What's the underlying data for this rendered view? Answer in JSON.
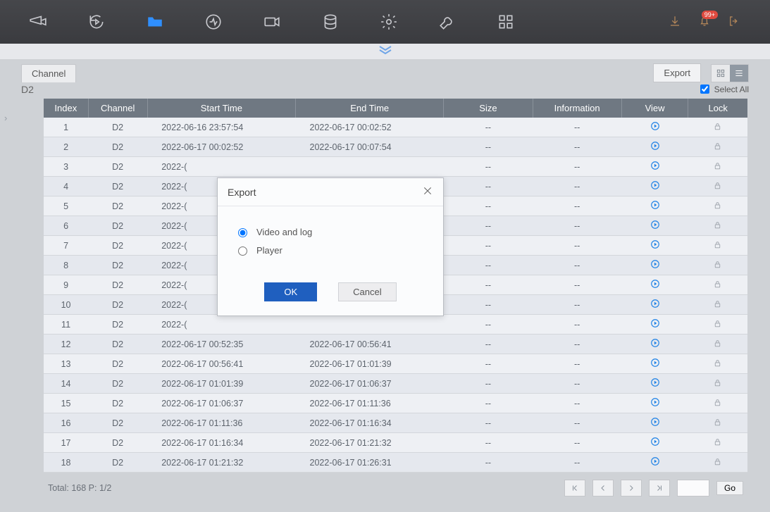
{
  "toolbar_icons": [
    "camera-icon",
    "playback-icon",
    "folder-icon",
    "health-icon",
    "record-icon",
    "database-icon",
    "settings-gear-icon",
    "maintenance-wrench-icon",
    "apps-grid-icon"
  ],
  "toolbar_right_badge": "99+",
  "tab_label": "Channel",
  "channel_name": "D2",
  "export_label": "Export",
  "select_all_label": "Select All",
  "columns": [
    "Index",
    "Channel",
    "Start Time",
    "End Time",
    "Size",
    "Information",
    "View",
    "Lock"
  ],
  "rows": [
    {
      "idx": "1",
      "ch": "D2",
      "start": "2022-06-16 23:57:54",
      "end": "2022-06-17 00:02:52",
      "size": "--",
      "info": "--"
    },
    {
      "idx": "2",
      "ch": "D2",
      "start": "2022-06-17 00:02:52",
      "end": "2022-06-17 00:07:54",
      "size": "--",
      "info": "--"
    },
    {
      "idx": "3",
      "ch": "D2",
      "start": "2022-(",
      "end": "",
      "size": "--",
      "info": "--"
    },
    {
      "idx": "4",
      "ch": "D2",
      "start": "2022-(",
      "end": "",
      "size": "--",
      "info": "--"
    },
    {
      "idx": "5",
      "ch": "D2",
      "start": "2022-(",
      "end": "",
      "size": "--",
      "info": "--"
    },
    {
      "idx": "6",
      "ch": "D2",
      "start": "2022-(",
      "end": "",
      "size": "--",
      "info": "--"
    },
    {
      "idx": "7",
      "ch": "D2",
      "start": "2022-(",
      "end": "",
      "size": "--",
      "info": "--"
    },
    {
      "idx": "8",
      "ch": "D2",
      "start": "2022-(",
      "end": "",
      "size": "--",
      "info": "--"
    },
    {
      "idx": "9",
      "ch": "D2",
      "start": "2022-(",
      "end": "",
      "size": "--",
      "info": "--"
    },
    {
      "idx": "10",
      "ch": "D2",
      "start": "2022-(",
      "end": "",
      "size": "--",
      "info": "--"
    },
    {
      "idx": "11",
      "ch": "D2",
      "start": "2022-(",
      "end": "",
      "size": "--",
      "info": "--"
    },
    {
      "idx": "12",
      "ch": "D2",
      "start": "2022-06-17 00:52:35",
      "end": "2022-06-17 00:56:41",
      "size": "--",
      "info": "--"
    },
    {
      "idx": "13",
      "ch": "D2",
      "start": "2022-06-17 00:56:41",
      "end": "2022-06-17 01:01:39",
      "size": "--",
      "info": "--"
    },
    {
      "idx": "14",
      "ch": "D2",
      "start": "2022-06-17 01:01:39",
      "end": "2022-06-17 01:06:37",
      "size": "--",
      "info": "--"
    },
    {
      "idx": "15",
      "ch": "D2",
      "start": "2022-06-17 01:06:37",
      "end": "2022-06-17 01:11:36",
      "size": "--",
      "info": "--"
    },
    {
      "idx": "16",
      "ch": "D2",
      "start": "2022-06-17 01:11:36",
      "end": "2022-06-17 01:16:34",
      "size": "--",
      "info": "--"
    },
    {
      "idx": "17",
      "ch": "D2",
      "start": "2022-06-17 01:16:34",
      "end": "2022-06-17 01:21:32",
      "size": "--",
      "info": "--"
    },
    {
      "idx": "18",
      "ch": "D2",
      "start": "2022-06-17 01:21:32",
      "end": "2022-06-17 01:26:31",
      "size": "--",
      "info": "--"
    }
  ],
  "footer": {
    "total_label": "Total: 168  P: 1/2",
    "go_label": "Go"
  },
  "modal": {
    "title": "Export",
    "opt1": "Video and log",
    "opt2": "Player",
    "ok": "OK",
    "cancel": "Cancel"
  }
}
